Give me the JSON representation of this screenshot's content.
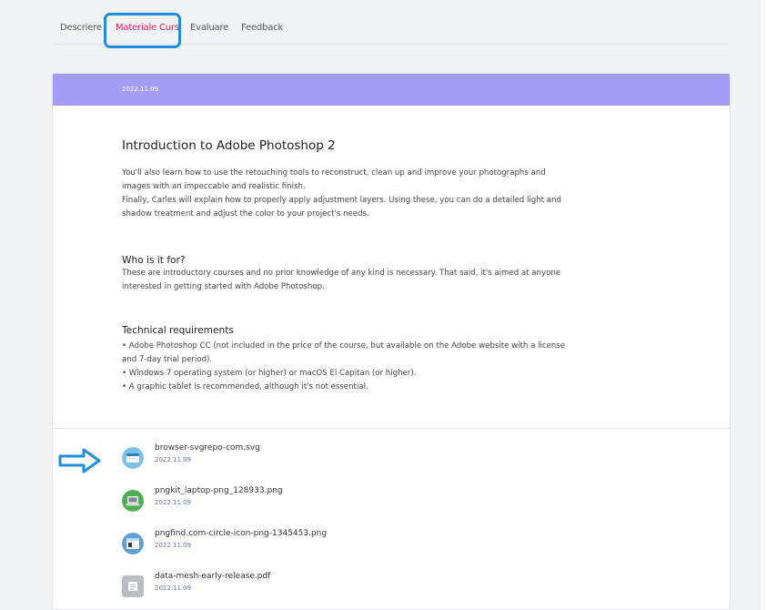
{
  "tabs": [
    {
      "label": "Descriere"
    },
    {
      "label": "Materiale Curs"
    },
    {
      "label": "Evaluare"
    },
    {
      "label": "Feedback"
    }
  ],
  "lesson": {
    "date": "2022.11.09",
    "title": "Introduction to Adobe Photoshop 2",
    "intro_lines": [
      "You'll also learn how to use the retouching tools to reconstruct, clean up and improve your photographs and",
      "images with an impeccable and realistic finish.",
      "Finally, Carles will explain how to properly apply adjustment layers. Using these, you can do a detailed light and",
      "shadow treatment and adjust the color to your project's needs."
    ],
    "who_title": "Who is it for?",
    "who_lines": [
      "These are introductory courses and no prior knowledge of any kind is necessary. That said, it's aimed at anyone",
      "interested in getting started with Adobe Photoshop."
    ],
    "tech_title": "Technical requirements",
    "tech_lines": [
      "• Adobe Photoshop CC (not included in the price of the course, but available on the Adobe website with a license",
      "and 7-day trial period).",
      "• Windows 7 operating system (or higher) or macOS El Capitan (or higher).",
      "• A graphic tablet is recommended, although it's not essential."
    ]
  },
  "files": [
    {
      "name": "browser-svgrepo-com.svg",
      "date": "2022.11.09",
      "icon": "browser-icon"
    },
    {
      "name": "pngkit_laptop-png_128933.png",
      "date": "2022.11.09",
      "icon": "laptop-icon"
    },
    {
      "name": "pngfind.com-circle-icon-png-1345453.png",
      "date": "2022.11.09",
      "icon": "window-icon"
    },
    {
      "name": "data-mesh-early-release.pdf",
      "date": "2022.11.09",
      "icon": "document-icon"
    }
  ],
  "colors": {
    "accent": "#e0245e",
    "header": "#a49cf7",
    "annotation": "#1d8fdc"
  }
}
